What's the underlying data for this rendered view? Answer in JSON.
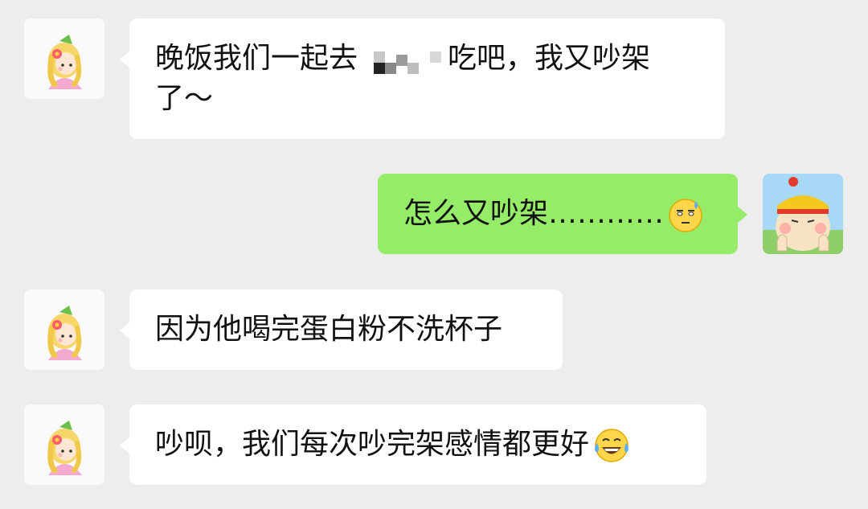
{
  "messages": [
    {
      "sender": "contact",
      "avatar_icon": "princess-girl-avatar-icon",
      "text_before_mosaic": "晚饭我们一起去",
      "redacted": true,
      "text_after_mosaic": "吃吧，我又吵架",
      "text_line2": "了～"
    },
    {
      "sender": "self",
      "avatar_icon": "monkey-king-avatar-icon",
      "text": "怎么又吵架…………",
      "emoji": "sweat-smile-emoji-icon"
    },
    {
      "sender": "contact",
      "avatar_icon": "princess-girl-avatar-icon",
      "text": "因为他喝完蛋白粉不洗杯子"
    },
    {
      "sender": "contact",
      "avatar_icon": "princess-girl-avatar-icon",
      "text": "吵呗，我们每次吵完架感情都更好",
      "emoji": "tears-of-joy-emoji-icon"
    }
  ],
  "colors": {
    "background": "#ededed",
    "incoming_bubble": "#ffffff",
    "outgoing_bubble": "#95ec69",
    "text": "#111111"
  }
}
